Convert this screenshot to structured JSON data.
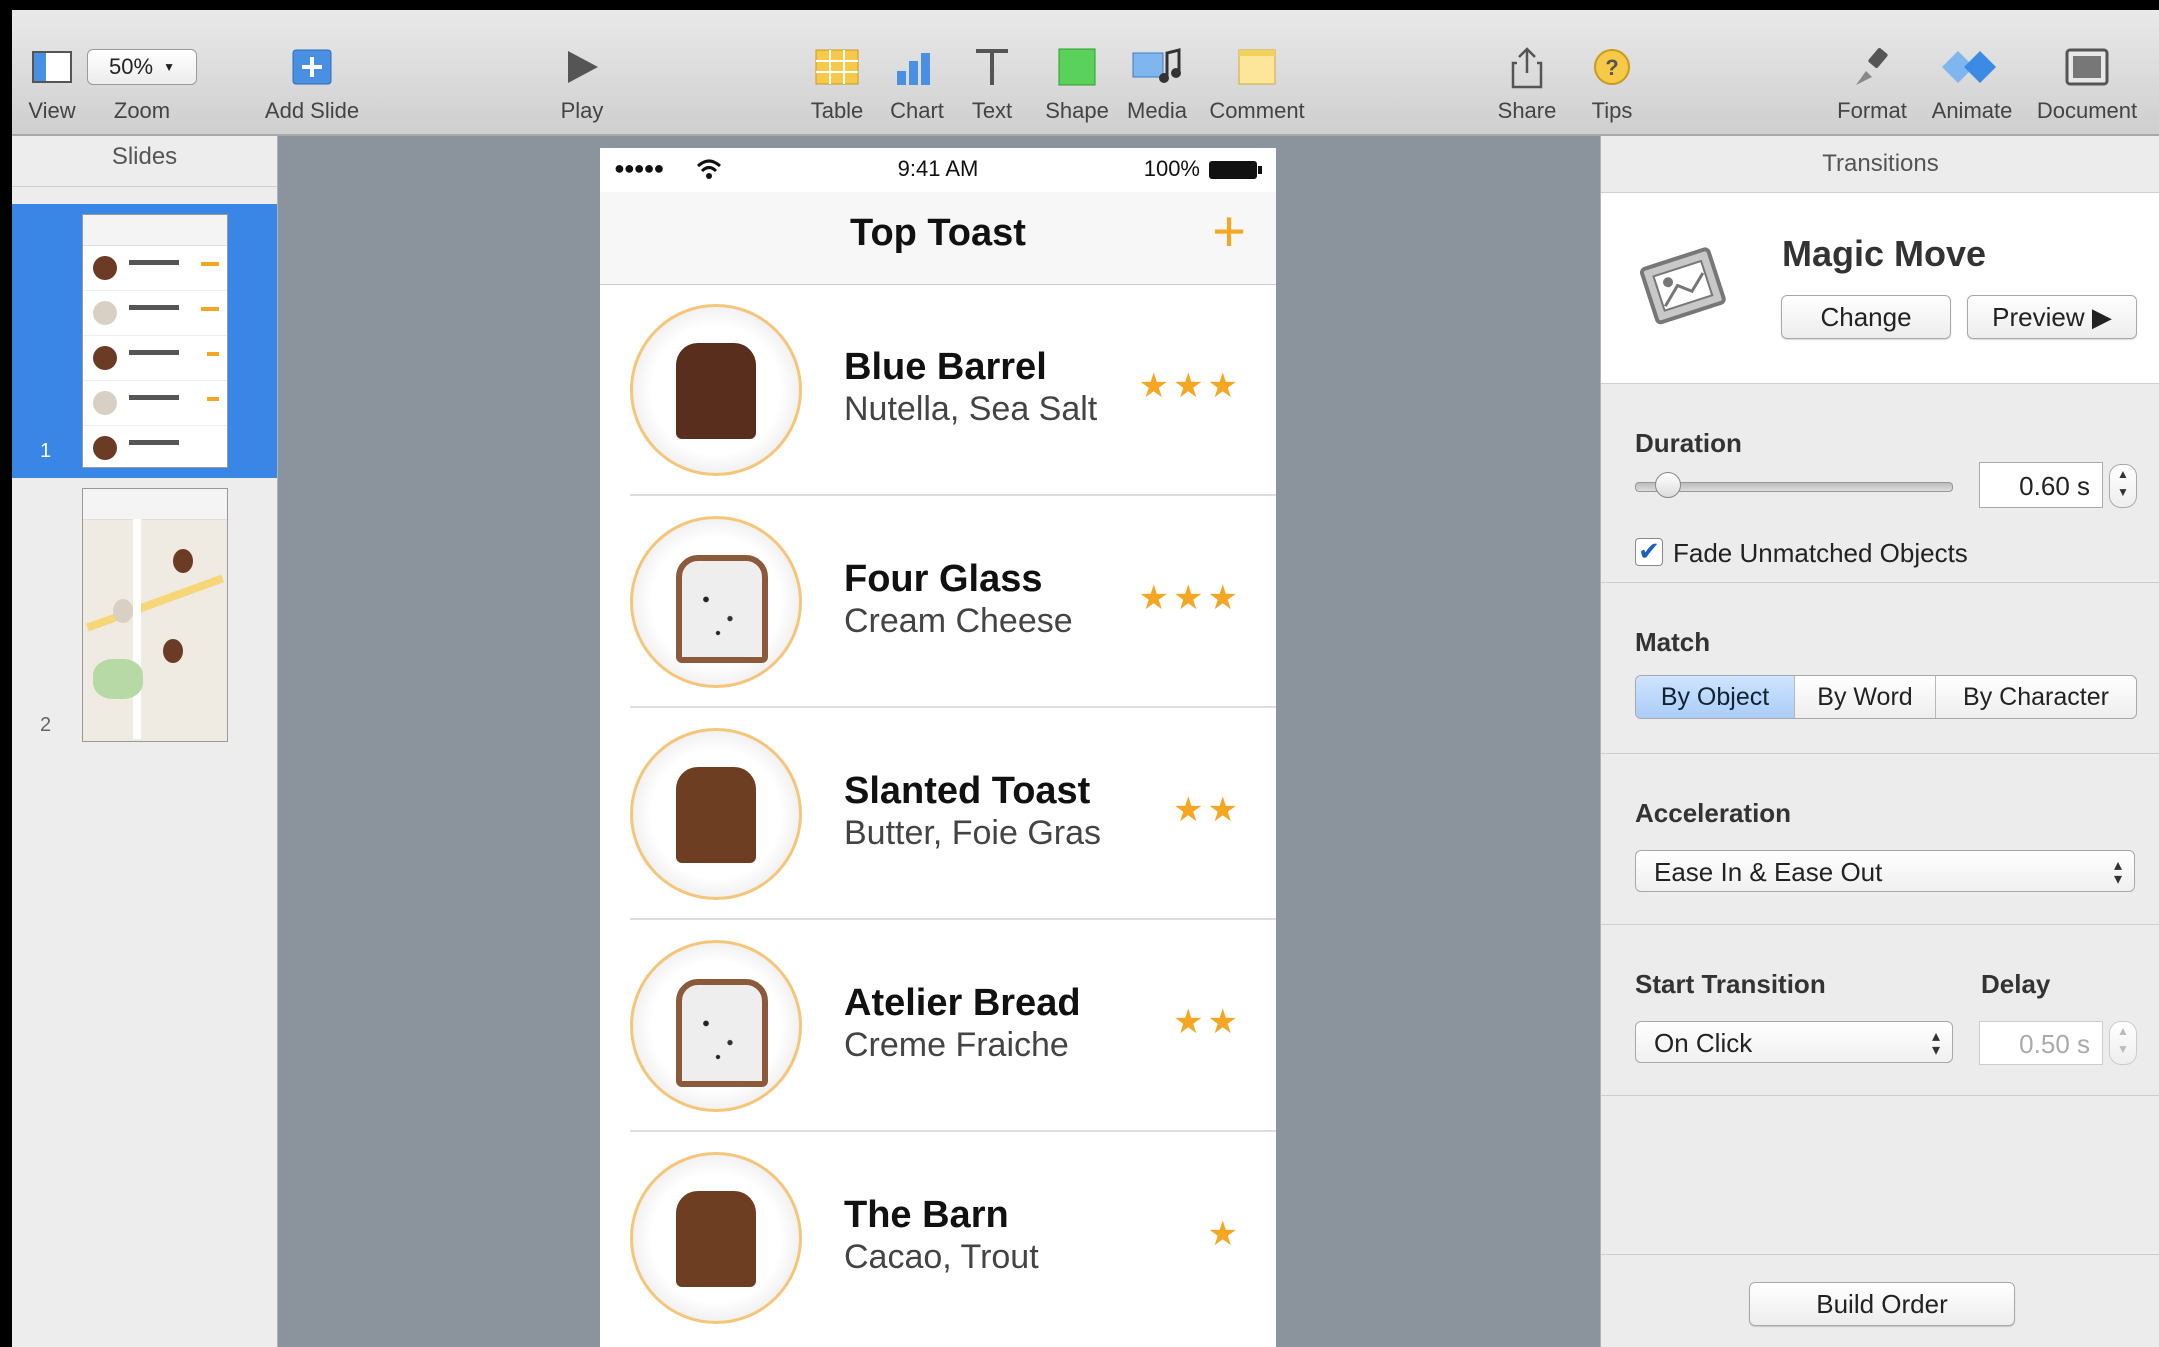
{
  "toolbar": {
    "view": "View",
    "zoom_value": "50%",
    "zoom": "Zoom",
    "add_slide": "Add Slide",
    "play": "Play",
    "table": "Table",
    "chart": "Chart",
    "text": "Text",
    "shape": "Shape",
    "media": "Media",
    "comment": "Comment",
    "share": "Share",
    "tips": "Tips",
    "format": "Format",
    "animate": "Animate",
    "document": "Document"
  },
  "slides_panel": {
    "title": "Slides",
    "items": [
      {
        "number": "1",
        "selected": true
      },
      {
        "number": "2",
        "selected": false
      }
    ]
  },
  "phone": {
    "time": "9:41 AM",
    "signal": "●●●●●",
    "battery": "100%",
    "title": "Top Toast",
    "add": "+",
    "rows": [
      {
        "name": "Blue Barrel",
        "sub": "Nutella, Sea Salt",
        "stars": "★★★",
        "rating": 3
      },
      {
        "name": "Four Glass",
        "sub": "Cream Cheese",
        "stars": "★★★",
        "rating": 3
      },
      {
        "name": "Slanted Toast",
        "sub": "Butter, Foie Gras",
        "stars": "★★",
        "rating": 2
      },
      {
        "name": "Atelier Bread",
        "sub": "Creme Fraiche",
        "stars": "★★",
        "rating": 2
      },
      {
        "name": "The Barn",
        "sub": "Cacao, Trout",
        "stars": "★",
        "rating": 1
      }
    ]
  },
  "inspector": {
    "title": "Transitions",
    "effect_name": "Magic Move",
    "change": "Change",
    "preview": "Preview ▶",
    "duration_title": "Duration",
    "duration_value": "0.60 s",
    "duration_slider_fraction": 0.1,
    "fade_label": "Fade Unmatched Objects",
    "fade_checked": true,
    "match_title": "Match",
    "match_options": [
      "By Object",
      "By Word",
      "By Character"
    ],
    "match_selected": "By Object",
    "acceleration_title": "Acceleration",
    "acceleration_value": "Ease In & Ease Out",
    "start_title": "Start Transition",
    "start_value": "On Click",
    "delay_title": "Delay",
    "delay_value": "0.50 s",
    "build_order": "Build Order"
  },
  "colors": {
    "accent_orange": "#f5a623",
    "selection_blue": "#3a86e6"
  }
}
